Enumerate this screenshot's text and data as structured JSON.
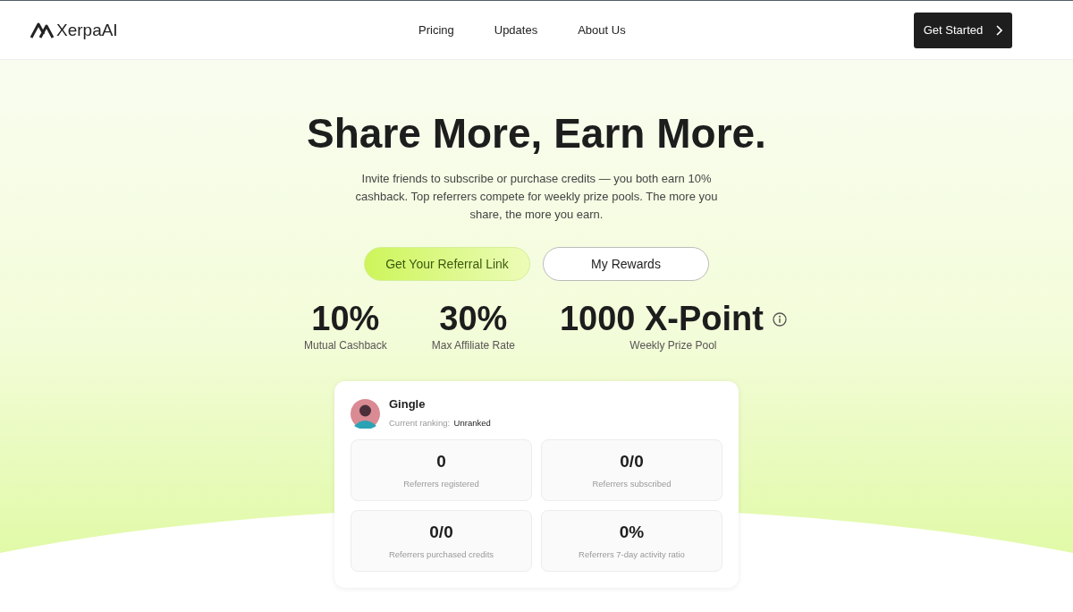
{
  "header": {
    "logo": "XerpaAI",
    "nav": [
      {
        "label": "Pricing"
      },
      {
        "label": "Updates"
      },
      {
        "label": "About Us"
      }
    ],
    "cta": "Get Started"
  },
  "hero": {
    "title": "Share More, Earn More.",
    "subtitle": "Invite friends to subscribe or purchase credits — you both earn 10% cashback. Top referrers compete for weekly prize pools. The more you share, the more you earn.",
    "buttons": [
      {
        "label": "Get Your Referral Link",
        "kind": "primary"
      },
      {
        "label": "My Rewards",
        "kind": "outline"
      }
    ],
    "stats": [
      {
        "value": "10%",
        "label": "Mutual Cashback",
        "info": false
      },
      {
        "value": "30%",
        "label": "Max Affiliate Rate",
        "info": false
      },
      {
        "value": "1000 X-Point",
        "label": "Weekly Prize Pool",
        "info": true
      }
    ]
  },
  "profile": {
    "name": "Gingle",
    "ranking_label": "Current ranking:",
    "ranking": "Unranked",
    "metrics": [
      {
        "value": "0",
        "label": "Referrers registered"
      },
      {
        "value": "0/0",
        "label": "Referrers subscribed"
      },
      {
        "value": "0/0",
        "label": "Referrers purchased credits"
      },
      {
        "value": "0%",
        "label": "Referrers 7-day activity ratio"
      }
    ]
  }
}
